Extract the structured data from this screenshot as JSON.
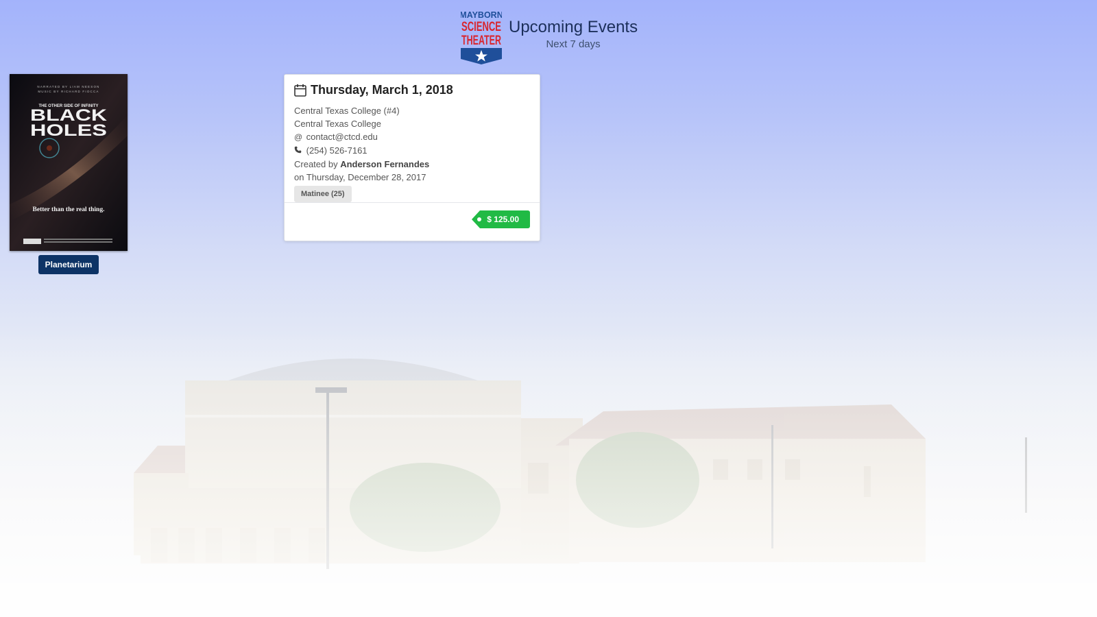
{
  "header": {
    "logo_text": [
      "MAYBORN",
      "SCIENCE",
      "THEATER"
    ],
    "title": "Upcoming Events",
    "subtitle": "Next 7 days"
  },
  "show": {
    "poster_text": {
      "credits_1": "NARRATED BY LIAM NEESON",
      "credits_2": "MUSIC BY RICHARD FIOCCA",
      "pretitle": "THE OTHER SIDE OF INFINITY",
      "title_1": "BLACK",
      "title_2": "HOLES",
      "tagline": "Better than the real thing."
    },
    "venue_label": "Planetarium"
  },
  "event": {
    "date": "Thursday, March 1, 2018",
    "group": "Central Texas College (#4)",
    "organization": "Central Texas College",
    "email": "contact@ctcd.edu",
    "phone": "(254) 526-7161",
    "created_prefix": "Created by",
    "created_by": "Anderson Fernandes",
    "created_on": "on Thursday, December 28, 2017",
    "tag": "Matinee (25)",
    "price": "$ 125.00",
    "icons": {
      "date": "calendar-icon",
      "email": "at-icon",
      "phone": "phone-icon",
      "price": "price-tag-icon"
    }
  },
  "colors": {
    "title": "#1c2f5a",
    "badge": "#0d3366",
    "price": "#21ba45",
    "logo_blue": "#1f4f9a",
    "logo_red": "#d9262e"
  }
}
